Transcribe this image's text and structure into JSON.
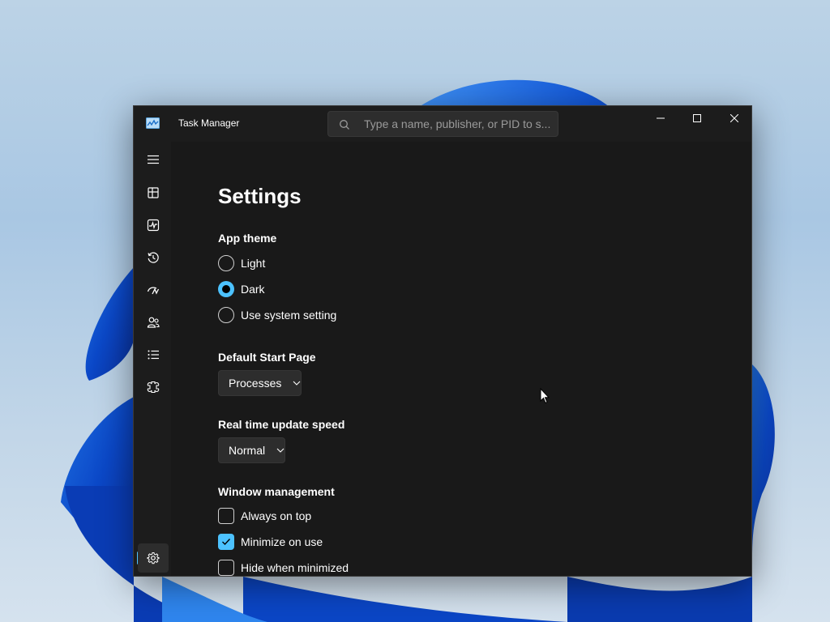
{
  "window": {
    "title": "Task Manager",
    "search": {
      "placeholder": "Type a name, publisher, or PID to s..."
    }
  },
  "nav": {
    "items": [
      {
        "name": "Menu",
        "icon": "hamburger-icon"
      },
      {
        "name": "Processes",
        "icon": "processes-icon"
      },
      {
        "name": "Performance",
        "icon": "performance-icon"
      },
      {
        "name": "App history",
        "icon": "history-icon"
      },
      {
        "name": "Startup apps",
        "icon": "startup-icon"
      },
      {
        "name": "Users",
        "icon": "users-icon"
      },
      {
        "name": "Details",
        "icon": "details-icon"
      },
      {
        "name": "Services",
        "icon": "services-icon"
      },
      {
        "name": "Settings",
        "icon": "gear-icon",
        "active": true
      }
    ]
  },
  "settings": {
    "title": "Settings",
    "app_theme": {
      "label": "App theme",
      "options": [
        {
          "label": "Light",
          "selected": false
        },
        {
          "label": "Dark",
          "selected": true
        },
        {
          "label": "Use system setting",
          "selected": false
        }
      ]
    },
    "default_start_page": {
      "label": "Default Start Page",
      "value": "Processes"
    },
    "update_speed": {
      "label": "Real time update speed",
      "value": "Normal"
    },
    "window_management": {
      "label": "Window management",
      "options": [
        {
          "label": "Always on top",
          "checked": false
        },
        {
          "label": "Minimize on use",
          "checked": true
        },
        {
          "label": "Hide when minimized",
          "checked": false
        }
      ]
    }
  },
  "colors": {
    "accent": "#4cc2ff",
    "window_bg": "#1c1c1c",
    "control_bg": "#2d2d2d"
  }
}
